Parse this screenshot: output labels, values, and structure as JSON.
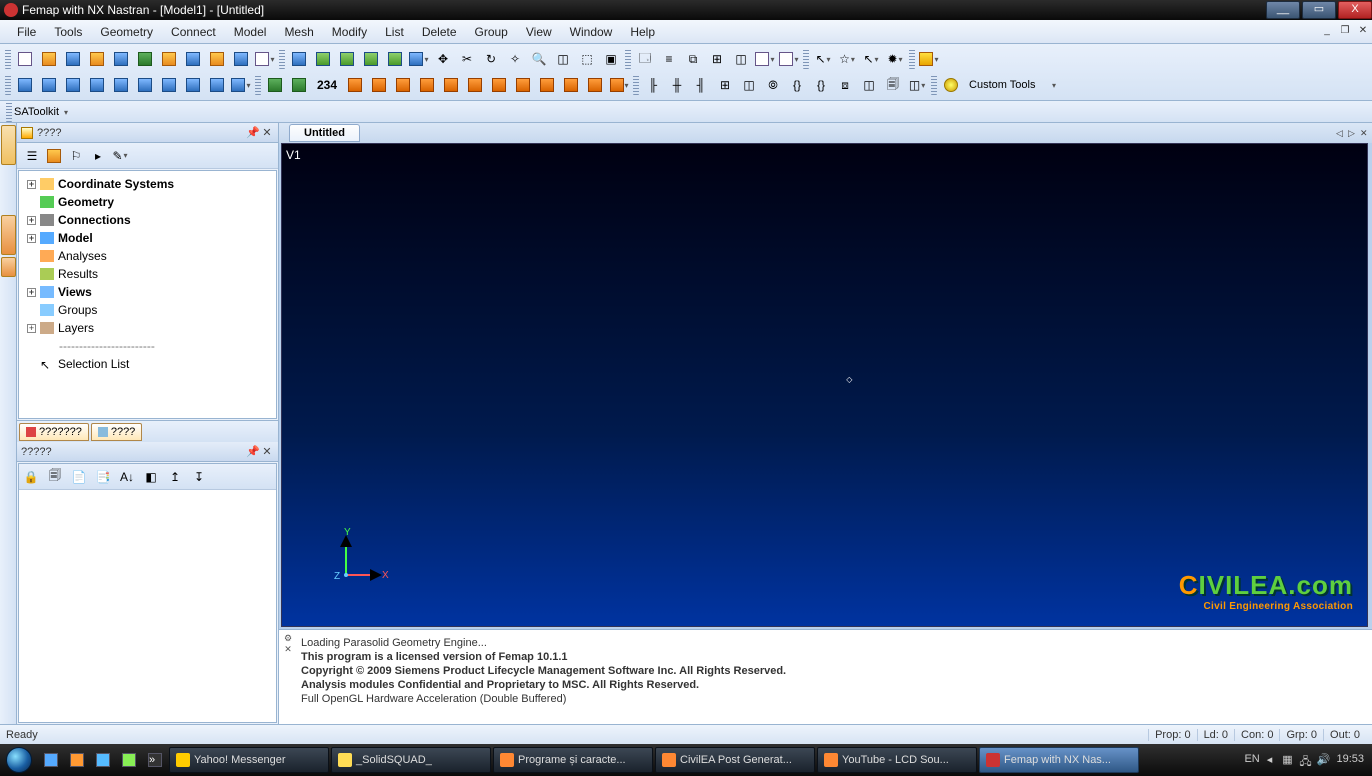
{
  "window": {
    "title": "Femap with NX Nastran - [Model1] - [Untitled]"
  },
  "menu": [
    "File",
    "Tools",
    "Geometry",
    "Connect",
    "Model",
    "Mesh",
    "Modify",
    "List",
    "Delete",
    "Group",
    "View",
    "Window",
    "Help"
  ],
  "satoolkit": "SAToolkit",
  "customtools": "Custom Tools",
  "num234": "234",
  "tree_panel": {
    "title": "????"
  },
  "tree": {
    "coord": "Coordinate Systems",
    "geom": "Geometry",
    "conn": "Connections",
    "model": "Model",
    "anal": "Analyses",
    "results": "Results",
    "views": "Views",
    "groups": "Groups",
    "layers": "Layers",
    "dash": "------------------------",
    "sel": "Selection List"
  },
  "bottom_tabs": {
    "t1": "???????",
    "t2": "????"
  },
  "props_panel": {
    "title": "?????"
  },
  "doc_tab": "Untitled",
  "viewport_label": "V1",
  "logo": {
    "line1_pre": "C",
    "line1_rest": "IVILEA.com",
    "line2": "Civil Engineering Association"
  },
  "axis": {
    "x": "X",
    "y": "Y",
    "z": "Z"
  },
  "messages": {
    "l0": "Loading Parasolid Geometry Engine...",
    "l1": "This program is a licensed version of Femap 10.1.1",
    "l2": "Copyright © 2009 Siemens Product Lifecycle Management Software Inc. All Rights Reserved.",
    "l3": "Analysis modules Confidential and Proprietary to MSC. All Rights Reserved.",
    "l4": "Full OpenGL Hardware Acceleration (Double Buffered)"
  },
  "status": {
    "ready": "Ready",
    "prop": "Prop: 0",
    "ld": "Ld: 0",
    "con": "Con: 0",
    "grp": "Grp: 0",
    "out": "Out: 0"
  },
  "taskbar": {
    "items": [
      "Yahoo! Messenger",
      "_SolidSQUAD_",
      "Programe și caracte...",
      "CivilEA Post Generat...",
      "YouTube - LCD Sou...",
      "Femap with NX Nas..."
    ]
  },
  "tray": {
    "lang": "EN",
    "clock": "19:53"
  }
}
